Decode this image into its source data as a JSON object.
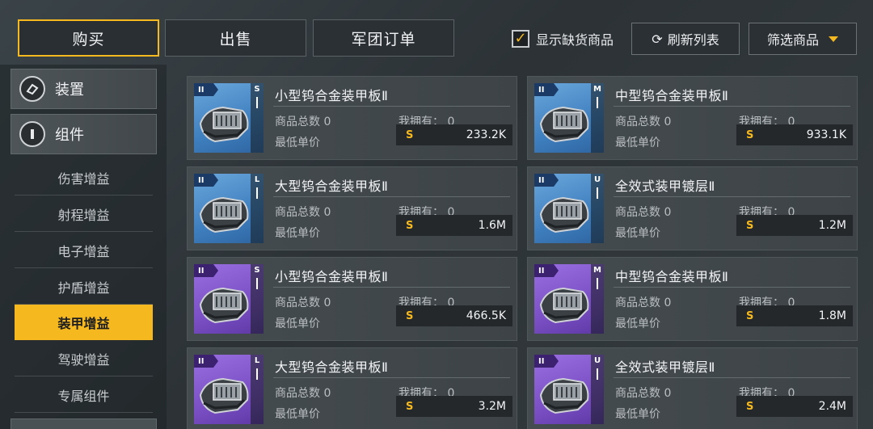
{
  "tabs": [
    {
      "label": "购买",
      "active": true
    },
    {
      "label": "出售",
      "active": false
    },
    {
      "label": "军团订单",
      "active": false
    }
  ],
  "toolbar": {
    "show_out_of_stock_label": "显示缺货商品",
    "show_out_of_stock_checked": true,
    "refresh_label": "刷新列表",
    "filter_label": "筛选商品"
  },
  "sidebar": {
    "categories": [
      {
        "label": "装置",
        "icon": "device-icon"
      },
      {
        "label": "组件",
        "icon": "component-icon"
      }
    ],
    "sub_items": [
      {
        "label": "伤害增益",
        "active": false
      },
      {
        "label": "射程增益",
        "active": false
      },
      {
        "label": "电子增益",
        "active": false
      },
      {
        "label": "护盾增益",
        "active": false
      },
      {
        "label": "装甲增益",
        "active": true
      },
      {
        "label": "驾驶增益",
        "active": false
      },
      {
        "label": "专属组件",
        "active": false
      }
    ]
  },
  "labels": {
    "total": "商品总数",
    "owned": "我拥有：",
    "min_price": "最低单价",
    "currency": "S"
  },
  "items": [
    {
      "name": "小型钨合金装甲板Ⅱ",
      "tier": "II",
      "size": "S",
      "color": "blue",
      "total": "0",
      "owned": "0",
      "price": "233.2K"
    },
    {
      "name": "中型钨合金装甲板Ⅱ",
      "tier": "II",
      "size": "M",
      "color": "blue",
      "total": "0",
      "owned": "0",
      "price": "933.1K"
    },
    {
      "name": "大型钨合金装甲板Ⅱ",
      "tier": "II",
      "size": "L",
      "color": "blue",
      "total": "0",
      "owned": "0",
      "price": "1.6M"
    },
    {
      "name": "全效式装甲镀层Ⅱ",
      "tier": "II",
      "size": "U",
      "color": "blue",
      "total": "0",
      "owned": "0",
      "price": "1.2M"
    },
    {
      "name": "小型钨合金装甲板Ⅱ",
      "tier": "II",
      "size": "S",
      "color": "purple",
      "total": "0",
      "owned": "0",
      "price": "466.5K"
    },
    {
      "name": "中型钨合金装甲板Ⅱ",
      "tier": "II",
      "size": "M",
      "color": "purple",
      "total": "0",
      "owned": "0",
      "price": "1.8M"
    },
    {
      "name": "大型钨合金装甲板Ⅱ",
      "tier": "II",
      "size": "L",
      "color": "purple",
      "total": "0",
      "owned": "0",
      "price": "3.2M"
    },
    {
      "name": "全效式装甲镀层Ⅱ",
      "tier": "II",
      "size": "U",
      "color": "purple",
      "total": "0",
      "owned": "0",
      "price": "2.4M"
    }
  ],
  "colors": {
    "accent": "#f5b81f",
    "rarity_blue": "#4f8fcf",
    "rarity_purple": "#8a5fd4"
  }
}
